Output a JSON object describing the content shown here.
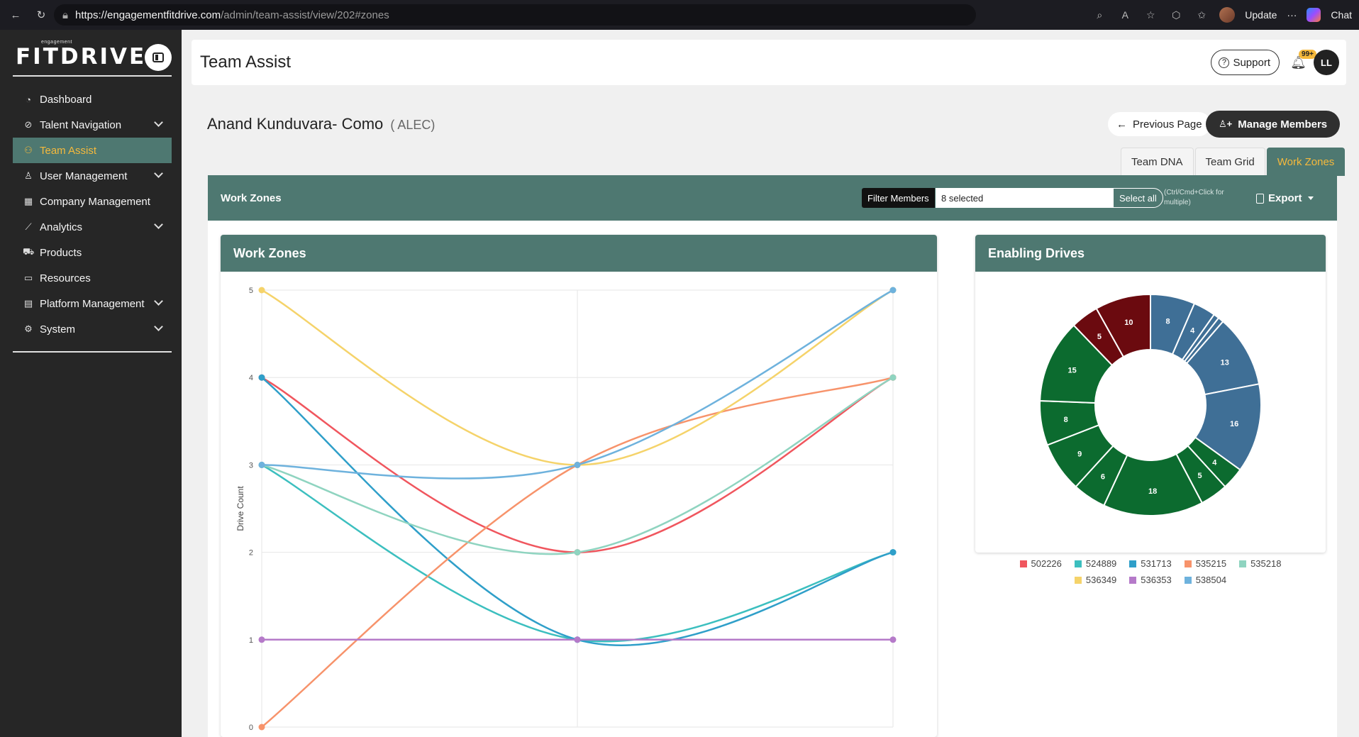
{
  "browser": {
    "url_host": "https://engagementfitdrive.com",
    "url_path": "/admin/team-assist/view/202#zones",
    "update_label": "Update",
    "chat_label": "Chat"
  },
  "sidebar": {
    "logo_text": "FITDRIVE",
    "logo_tagline": "engagement",
    "items": [
      {
        "label": "Dashboard",
        "icon": "dashboard-icon"
      },
      {
        "label": "Talent Navigation",
        "icon": "compass-icon"
      },
      {
        "label": "Team Assist",
        "icon": "team-icon"
      },
      {
        "label": "User Management",
        "icon": "user-icon"
      },
      {
        "label": "Company Management",
        "icon": "building-icon"
      },
      {
        "label": "Analytics",
        "icon": "chart-icon"
      },
      {
        "label": "Products",
        "icon": "cart-icon"
      },
      {
        "label": "Resources",
        "icon": "book-icon"
      },
      {
        "label": "Platform Management",
        "icon": "platform-icon"
      },
      {
        "label": "System",
        "icon": "gear-icon"
      }
    ]
  },
  "header": {
    "title": "Team Assist",
    "support_label": "Support",
    "notification_badge": "99+",
    "user_initials": "LL"
  },
  "member": {
    "name": "Anand Kunduvara- Como",
    "code": "( ALEC)"
  },
  "actions": {
    "previous_label": "Previous Page",
    "manage_label": "Manage Members"
  },
  "tabs": [
    "Team DNA",
    "Team Grid",
    "Work Zones"
  ],
  "panel": {
    "title": "Work Zones",
    "filter_label": "Filter Members",
    "filter_value": "8 selected",
    "select_all_label": "Select all",
    "hint": "(Ctrl/Cmd+Click for multiple)",
    "export_label": "Export"
  },
  "colors": {
    "accent": "#4e7871",
    "highlight": "#f5b93c"
  },
  "chart_data": [
    {
      "type": "line",
      "title": "Work Zones",
      "ylabel": "Drive Count",
      "ylim": [
        0,
        5
      ],
      "yticks": [
        "0",
        "1",
        "2",
        "3",
        "4",
        "5"
      ],
      "x": [
        0,
        1,
        2
      ],
      "series": [
        {
          "name": "502226",
          "color": "#f0565e",
          "values": [
            4,
            2,
            4
          ]
        },
        {
          "name": "524889",
          "color": "#3cbfbf",
          "values": [
            3,
            1,
            2
          ]
        },
        {
          "name": "531713",
          "color": "#2f9fc9",
          "values": [
            4,
            1,
            2
          ]
        },
        {
          "name": "535215",
          "color": "#f7936b",
          "values": [
            0,
            3,
            4
          ]
        },
        {
          "name": "535218",
          "color": "#8fd4c0",
          "values": [
            3,
            2,
            4
          ]
        },
        {
          "name": "536349",
          "color": "#f5d36a",
          "values": [
            5,
            3,
            5
          ]
        },
        {
          "name": "536353",
          "color": "#b57ac9",
          "values": [
            1,
            1,
            1
          ]
        },
        {
          "name": "538504",
          "color": "#6eb2dd",
          "values": [
            3,
            3,
            5
          ]
        }
      ]
    },
    {
      "type": "pie",
      "title": "Enabling Drives",
      "slices": [
        {
          "value": 8,
          "color": "#3f6f96"
        },
        {
          "value": 4,
          "color": "#3f6f96"
        },
        {
          "value": 1,
          "color": "#3f6f96"
        },
        {
          "value": 1,
          "color": "#3f6f96"
        },
        {
          "value": 13,
          "color": "#3f6f96"
        },
        {
          "value": 16,
          "color": "#3f6f96"
        },
        {
          "value": 4,
          "color": "#0c6b2f"
        },
        {
          "value": 5,
          "color": "#0c6b2f"
        },
        {
          "value": 18,
          "color": "#0c6b2f"
        },
        {
          "value": 6,
          "color": "#0c6b2f"
        },
        {
          "value": 9,
          "color": "#0c6b2f"
        },
        {
          "value": 8,
          "color": "#0c6b2f"
        },
        {
          "value": 15,
          "color": "#0c6b2f"
        },
        {
          "value": 5,
          "color": "#6b0a0f"
        },
        {
          "value": 10,
          "color": "#6b0a0f"
        }
      ],
      "legend": [
        "502226",
        "524889",
        "531713",
        "535215",
        "535218",
        "536349",
        "536353",
        "538504"
      ]
    }
  ]
}
